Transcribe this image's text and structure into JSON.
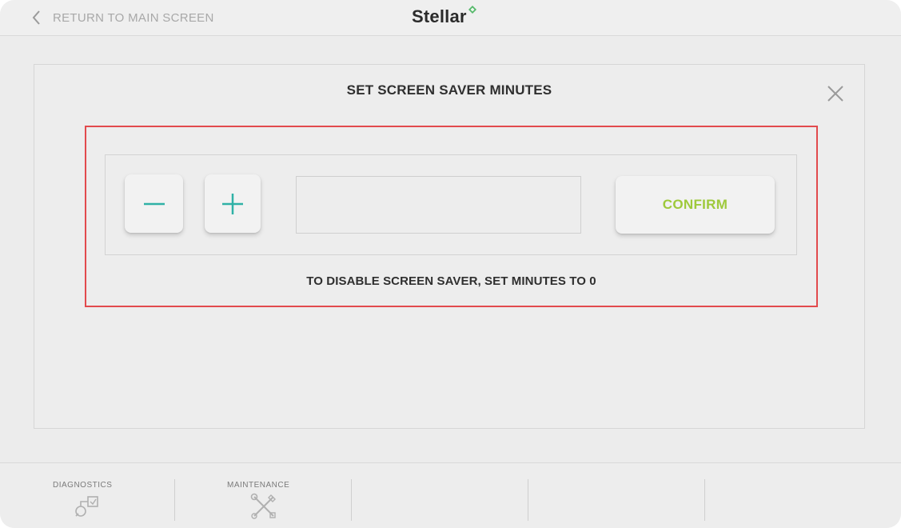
{
  "topbar": {
    "back_label": "RETURN TO MAIN SCREEN",
    "back_icon": "chevron-left-icon",
    "brand_name": "Stellar",
    "brand_icon": "leaf-icon",
    "brand_accent_color": "#55b86a"
  },
  "dialog": {
    "title": "SET SCREEN SAVER MINUTES",
    "close_icon": "close-icon",
    "minus_label": "−",
    "plus_label": "+",
    "minutes_value": "",
    "confirm_label": "CONFIRM",
    "hint": "TO DISABLE SCREEN SAVER, SET MINUTES TO 0",
    "accent_color": "#9ec93b",
    "stepper_icon_color": "#2fb1a6",
    "highlight_color": "#e24a4d"
  },
  "bottomnav": {
    "items": [
      {
        "label": "DIAGNOSTICS",
        "icon": "diagnostics-icon"
      },
      {
        "label": "MAINTENANCE",
        "icon": "tools-icon"
      },
      {
        "label": "",
        "icon": ""
      },
      {
        "label": "",
        "icon": ""
      },
      {
        "label": "",
        "icon": ""
      }
    ]
  }
}
